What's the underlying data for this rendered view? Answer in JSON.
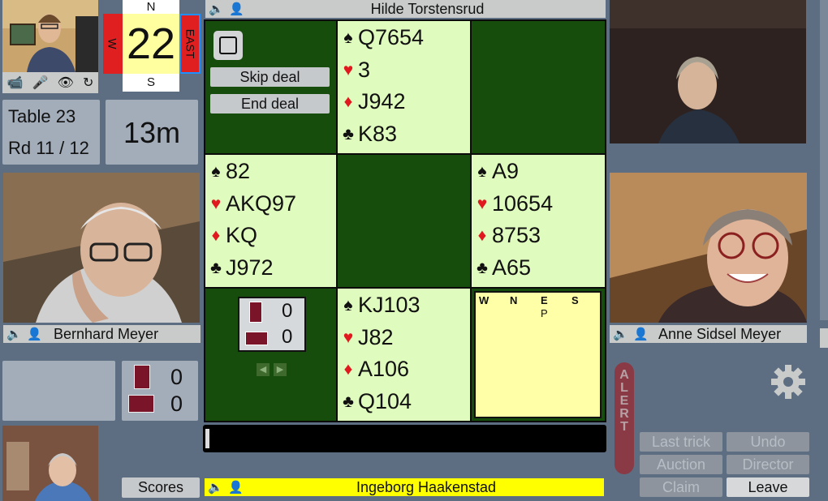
{
  "table": {
    "label": "Table 23",
    "round": "Rd 11 / 12",
    "timer": "13m"
  },
  "compass": {
    "north": "N",
    "south": "S",
    "west": "W",
    "east": "EAST",
    "board_number": "22"
  },
  "players": {
    "north": "Hilde Torstensrud",
    "west": "Bernhard Meyer",
    "east": "Anne Sidsel Meyer",
    "south": "Ingeborg Haakenstad"
  },
  "hands": {
    "north": {
      "spades": "Q7654",
      "hearts": "3",
      "diamonds": "J942",
      "clubs": "K83"
    },
    "west": {
      "spades": "82",
      "hearts": "AKQ97",
      "diamonds": "KQ",
      "clubs": "J972"
    },
    "east": {
      "spades": "A9",
      "hearts": "10654",
      "diamonds": "8753",
      "clubs": "A65"
    },
    "south": {
      "spades": "KJ103",
      "hearts": "J82",
      "diamonds": "A106",
      "clubs": "Q104"
    }
  },
  "suit_symbols": {
    "spades": "♠",
    "hearts": "♥",
    "diamonds": "♦",
    "clubs": "♣"
  },
  "controls": {
    "skip_deal": "Skip deal",
    "end_deal": "End deal"
  },
  "tricks_board": {
    "ns": "0",
    "ew": "0"
  },
  "tricks_panel": {
    "ns": "0",
    "ew": "0"
  },
  "bidding": {
    "headers": [
      "W",
      "N",
      "E",
      "S"
    ],
    "bids": [
      "",
      "",
      "P",
      ""
    ]
  },
  "buttons": {
    "scores": "Scores",
    "last_trick": "Last trick",
    "undo": "Undo",
    "auction": "Auction",
    "director": "Director",
    "claim": "Claim",
    "leave": "Leave",
    "alert": "ALERT"
  },
  "icons": [
    "speaker-icon",
    "add-person-icon",
    "camera-icon",
    "mic-icon",
    "eye-icon",
    "refresh-icon",
    "gear-icon"
  ],
  "colors": {
    "background": "#5d6e83",
    "table_green": "#174d0c",
    "card_light": "#e0fbbe",
    "south_bar": "#ffff00",
    "board_number_bg": "#ffffa0"
  }
}
